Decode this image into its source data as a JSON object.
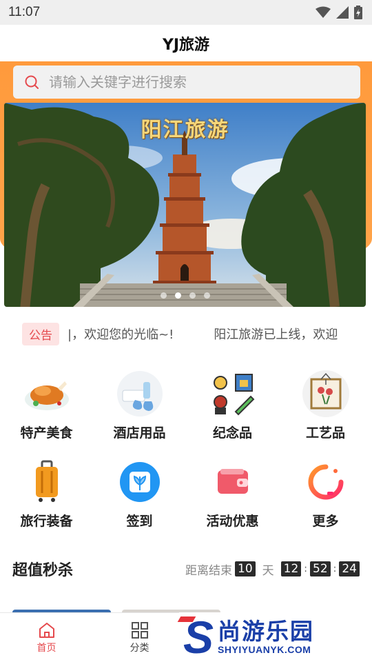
{
  "status": {
    "time": "11:07"
  },
  "nav": {
    "title": "YJ旅游"
  },
  "search": {
    "placeholder": "请输入关键字进行搜索"
  },
  "banner": {
    "title": "阳江旅游",
    "slide_count": 4,
    "active_slide": 2
  },
  "notice": {
    "badge": "公告",
    "text": "|，欢迎您的光临~!",
    "text2": "阳江旅游已上线，欢迎"
  },
  "categories": [
    {
      "label": "特产美食",
      "icon": "roast-chicken-icon"
    },
    {
      "label": "酒店用品",
      "icon": "hotel-supplies-icon"
    },
    {
      "label": "纪念品",
      "icon": "souvenir-icon"
    },
    {
      "label": "工艺品",
      "icon": "craft-painting-icon"
    },
    {
      "label": "旅行装备",
      "icon": "luggage-icon"
    },
    {
      "label": "签到",
      "icon": "sign-in-book-icon"
    },
    {
      "label": "活动优惠",
      "icon": "wallet-icon"
    },
    {
      "label": "更多",
      "icon": "more-ring-icon"
    }
  ],
  "sale": {
    "title": "超值秒杀",
    "ends_label": "距离结束",
    "days": "10",
    "days_unit": "天",
    "hours": "12",
    "minutes": "52",
    "seconds": "24"
  },
  "tabs": [
    {
      "label": "首页",
      "icon": "home-icon",
      "active": true
    },
    {
      "label": "分类",
      "icon": "grid-icon",
      "active": false
    }
  ],
  "watermark": {
    "brand": "尚游乐园",
    "url": "SHYIYUANYK.COM",
    "letter": "S"
  },
  "colors": {
    "accent": "#e5494d",
    "orange": "#ff9a3c",
    "watermark": "#1a3fa8"
  }
}
